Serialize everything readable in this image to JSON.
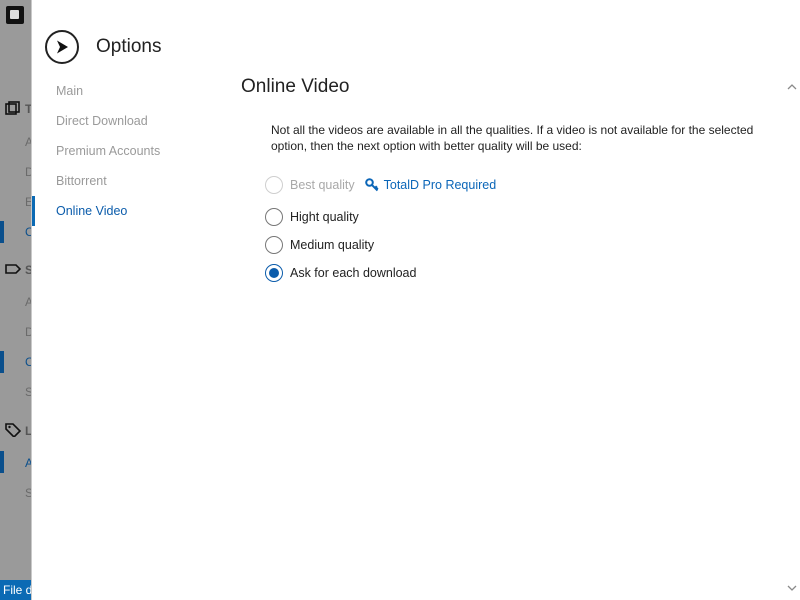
{
  "background_app": {
    "section_letters": [
      "T",
      "S",
      "L"
    ],
    "sub_letters": [
      "A",
      "D",
      "E",
      "C",
      "A",
      "D",
      "C",
      "S",
      "A",
      "S"
    ],
    "status_text": "File d"
  },
  "dialog": {
    "title": "Options",
    "nav": [
      {
        "label": "Main",
        "active": false
      },
      {
        "label": "Direct Download",
        "active": false
      },
      {
        "label": "Premium Accounts",
        "active": false
      },
      {
        "label": "Bittorrent",
        "active": false
      },
      {
        "label": "Online Video",
        "active": true
      }
    ],
    "section_title": "Online Video",
    "description": "Not all the videos are available in all the qualities. If a video is not available for the selected option, then the next option with better quality will be used:",
    "options": [
      {
        "label": "Best quality",
        "selected": false,
        "disabled": true
      },
      {
        "label": "Hight quality",
        "selected": false,
        "disabled": false
      },
      {
        "label": "Medium quality",
        "selected": false,
        "disabled": false
      },
      {
        "label": "Ask for each download",
        "selected": true,
        "disabled": false
      }
    ],
    "pro_link": "TotalD Pro Required"
  },
  "colors": {
    "accent": "#0b5cab",
    "status_bar": "#0b6ab4",
    "disabled_text": "#a9a9a9"
  },
  "icons": {
    "back": "chevron-right-icon",
    "pro": "key-icon"
  }
}
